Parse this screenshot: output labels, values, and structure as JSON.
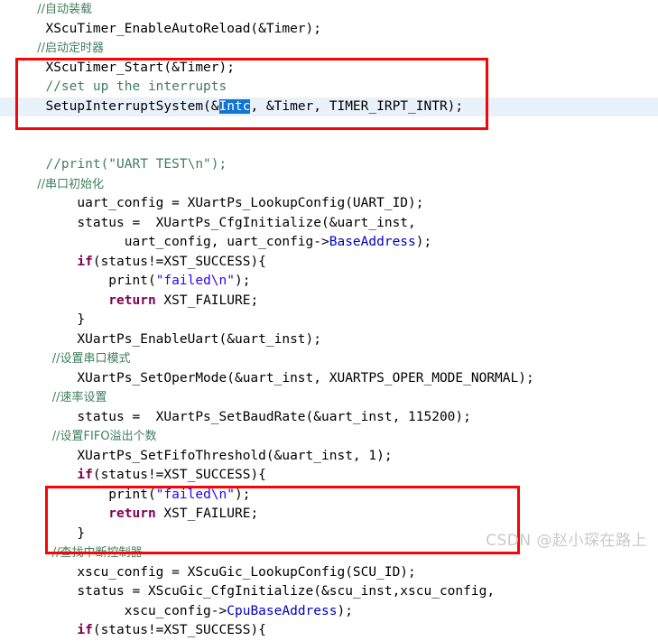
{
  "editor": {
    "language": "c",
    "colors": {
      "background": "#ffffff",
      "text": "#000000",
      "comment": "#3f7f5f",
      "keyword": "#7f0055",
      "string": "#2a00ff",
      "field": "#0000c0",
      "selection_bg": "#1275d1",
      "selection_fg": "#ffffff",
      "current_line_bg": "#e9f1fb",
      "annotation_red": "#f70404",
      "watermark": "#c9c9c9"
    },
    "selection": {
      "text": "Intc",
      "line": 6
    },
    "annotations": [
      {
        "name": "interrupt-setup-highlight",
        "shape": "rectangle",
        "color": "#f70404"
      },
      {
        "name": "scugic-init-highlight",
        "shape": "rectangle",
        "color": "#f70404"
      }
    ],
    "lines": [
      {
        "indent": 2,
        "tokens": [
          {
            "t": "cmt",
            "v": "//自动装载",
            "cjk": true
          }
        ]
      },
      {
        "indent": 2,
        "tokens": [
          {
            "t": "",
            "v": "XScuTimer_EnableAutoReload(&Timer);"
          }
        ]
      },
      {
        "indent": 2,
        "tokens": [
          {
            "t": "cmt",
            "v": "//启动定时器",
            "cjk": true
          }
        ]
      },
      {
        "indent": 2,
        "tokens": [
          {
            "t": "",
            "v": "XScuTimer_Start(&Timer);"
          }
        ]
      },
      {
        "indent": 2,
        "tokens": [
          {
            "t": "cmt",
            "v": "//set up the interrupts"
          }
        ]
      },
      {
        "indent": 2,
        "highlight": true,
        "tokens": [
          {
            "t": "",
            "v": "SetupInterruptSystem(&"
          },
          {
            "t": "sel",
            "v": "Intc"
          },
          {
            "t": "",
            "v": ", &Timer, TIMER_IRPT_INTR);"
          }
        ]
      },
      {
        "indent": 2,
        "tokens": [
          {
            "t": "",
            "v": ""
          }
        ]
      },
      {
        "indent": 2,
        "tokens": [
          {
            "t": "",
            "v": ""
          }
        ]
      },
      {
        "indent": 2,
        "tokens": [
          {
            "t": "cmt",
            "v": "//print(\"UART TEST\\n\");"
          }
        ]
      },
      {
        "indent": 2,
        "tokens": [
          {
            "t": "cmt",
            "v": "//串口初始化",
            "cjk": true
          }
        ]
      },
      {
        "indent": 6,
        "tokens": [
          {
            "t": "",
            "v": "uart_config = XUartPs_LookupConfig(UART_ID);"
          }
        ]
      },
      {
        "indent": 6,
        "tokens": [
          {
            "t": "",
            "v": "status =  XUartPs_CfgInitialize(&uart_inst,"
          }
        ]
      },
      {
        "indent": 12,
        "tokens": [
          {
            "t": "",
            "v": "uart_config, uart_config->"
          },
          {
            "t": "fld",
            "v": "BaseAddress"
          },
          {
            "t": "",
            "v": ");"
          }
        ]
      },
      {
        "indent": 6,
        "tokens": [
          {
            "t": "kw",
            "v": "if"
          },
          {
            "t": "",
            "v": "(status!=XST_SUCCESS){"
          }
        ]
      },
      {
        "indent": 10,
        "tokens": [
          {
            "t": "",
            "v": "print("
          },
          {
            "t": "str",
            "v": "\"failed\\n\""
          },
          {
            "t": "",
            "v": ");"
          }
        ]
      },
      {
        "indent": 10,
        "tokens": [
          {
            "t": "kw",
            "v": "return"
          },
          {
            "t": "",
            "v": " XST_FAILURE;"
          }
        ]
      },
      {
        "indent": 6,
        "tokens": [
          {
            "t": "",
            "v": "}"
          }
        ]
      },
      {
        "indent": 6,
        "tokens": [
          {
            "t": "",
            "v": "XUartPs_EnableUart(&uart_inst);"
          }
        ]
      },
      {
        "indent": 6,
        "tokens": [
          {
            "t": "cmt",
            "v": "//设置串口模式",
            "cjk": true
          }
        ]
      },
      {
        "indent": 6,
        "tokens": [
          {
            "t": "",
            "v": "XUartPs_SetOperMode(&uart_inst, XUARTPS_OPER_MODE_NORMAL);"
          }
        ]
      },
      {
        "indent": 6,
        "tokens": [
          {
            "t": "cmt",
            "v": "//速率设置",
            "cjk": true
          }
        ]
      },
      {
        "indent": 6,
        "tokens": [
          {
            "t": "",
            "v": "status =  XUartPs_SetBaudRate(&uart_inst, 115200);"
          }
        ]
      },
      {
        "indent": 6,
        "tokens": [
          {
            "t": "cmt",
            "v": "//设置FIFO溢出个数",
            "cjk": true
          }
        ]
      },
      {
        "indent": 6,
        "tokens": [
          {
            "t": "",
            "v": "XUartPs_SetFifoThreshold(&uart_inst, 1);"
          }
        ]
      },
      {
        "indent": 6,
        "tokens": [
          {
            "t": "kw",
            "v": "if"
          },
          {
            "t": "",
            "v": "(status!=XST_SUCCESS){"
          }
        ]
      },
      {
        "indent": 10,
        "tokens": [
          {
            "t": "",
            "v": "print("
          },
          {
            "t": "str",
            "v": "\"failed\\n\""
          },
          {
            "t": "",
            "v": ");"
          }
        ]
      },
      {
        "indent": 10,
        "tokens": [
          {
            "t": "kw",
            "v": "return"
          },
          {
            "t": "",
            "v": " XST_FAILURE;"
          }
        ]
      },
      {
        "indent": 6,
        "tokens": [
          {
            "t": "",
            "v": "}"
          }
        ]
      },
      {
        "indent": 6,
        "tokens": [
          {
            "t": "cmt",
            "v": "//查找中断控制器",
            "cjk": true
          }
        ]
      },
      {
        "indent": 6,
        "tokens": [
          {
            "t": "",
            "v": "xscu_config = XScuGic_LookupConfig(SCU_ID);"
          }
        ]
      },
      {
        "indent": 6,
        "tokens": [
          {
            "t": "",
            "v": "status = XScuGic_CfgInitialize(&scu_inst,xscu_config,"
          }
        ]
      },
      {
        "indent": 12,
        "tokens": [
          {
            "t": "",
            "v": "xscu_config->"
          },
          {
            "t": "fld",
            "v": "CpuBaseAddress"
          },
          {
            "t": "",
            "v": ");"
          }
        ]
      },
      {
        "indent": 6,
        "tokens": [
          {
            "t": "kw",
            "v": "if"
          },
          {
            "t": "",
            "v": "(status!=XST_SUCCESS){"
          }
        ]
      }
    ]
  },
  "watermark": {
    "text": "CSDN @赵小琛在路上"
  }
}
